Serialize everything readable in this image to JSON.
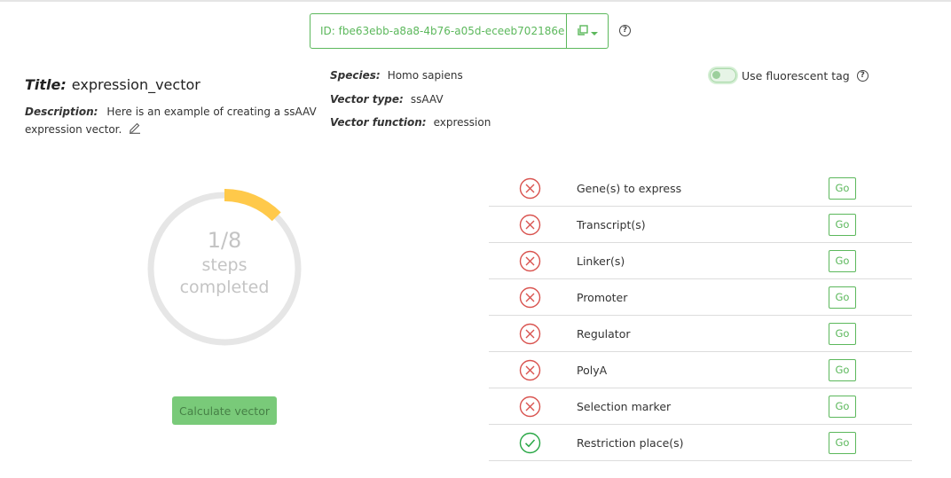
{
  "vector_id": "ID: fbe63ebb-a8a8-4b76-a05d-eceeb702186e",
  "icons": {
    "copy": "copy-icon",
    "dropdown": "chevron-down-icon",
    "help": "question-circle-icon",
    "edit": "pencil-icon",
    "incomplete": "x-circle-icon",
    "complete": "check-circle-icon"
  },
  "title": {
    "label": "Title:",
    "value": "expression_vector"
  },
  "description": {
    "label": "Description:",
    "value": "Here is an example of creating a ssAAV expression vector."
  },
  "meta": {
    "species": {
      "label": "Species:",
      "value": "Homo sapiens"
    },
    "vector_type": {
      "label": "Vector type:",
      "value": "ssAAV"
    },
    "vector_function": {
      "label": "Vector function:",
      "value": "expression"
    }
  },
  "fluorescent_toggle": {
    "label": "Use fluorescent tag",
    "enabled": false
  },
  "progress": {
    "count": "1/8",
    "line1": "steps",
    "line2": "completed",
    "completed": 1,
    "total": 8
  },
  "calculate_button": "Calculate vector",
  "steps": [
    {
      "label": "Gene(s) to express",
      "status": "incomplete",
      "go": "Go"
    },
    {
      "label": "Transcript(s)",
      "status": "incomplete",
      "go": "Go"
    },
    {
      "label": "Linker(s)",
      "status": "incomplete",
      "go": "Go"
    },
    {
      "label": "Promoter",
      "status": "incomplete",
      "go": "Go"
    },
    {
      "label": "Regulator",
      "status": "incomplete",
      "go": "Go"
    },
    {
      "label": "PolyA",
      "status": "incomplete",
      "go": "Go"
    },
    {
      "label": "Selection marker",
      "status": "incomplete",
      "go": "Go"
    },
    {
      "label": "Restriction place(s)",
      "status": "complete",
      "go": "Go"
    }
  ],
  "colors": {
    "accent": "#5cb85c",
    "error": "#d9534f",
    "success": "#28a745",
    "progress": "#ffc94a",
    "track": "#e6e6e6"
  }
}
